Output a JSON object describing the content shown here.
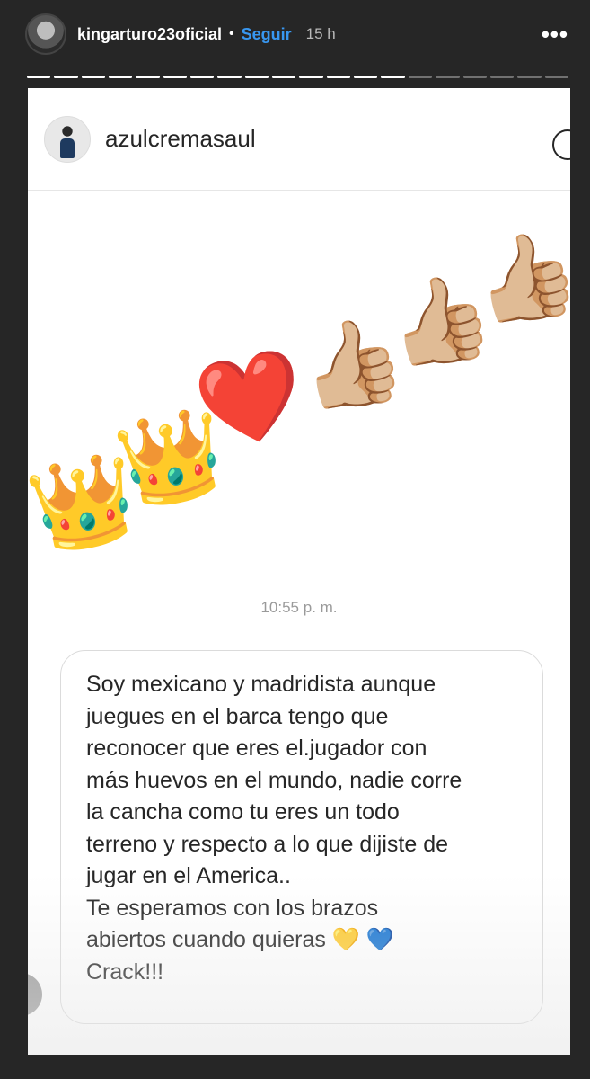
{
  "story": {
    "username": "kingarturo23oficial",
    "separator": "•",
    "follow_label": "Seguir",
    "time_ago": "15 h",
    "more_label": "•••",
    "progress": {
      "segments": 20,
      "completed": 14
    }
  },
  "dm": {
    "username": "azulcremasaul",
    "emojis": [
      "👑",
      "👑",
      "❤️",
      "👍🏼",
      "👍🏼",
      "👍🏼"
    ],
    "timestamp": "10:55 p. m.",
    "message": "Soy mexicano y madridista aunque\njuegues en el barca tengo que\nreconocer que eres el.jugador con\nmás huevos en el mundo, nadie corre\nla cancha como tu eres un todo\nterreno y respecto a lo que dijiste de\njugar en el America..\nTe esperamos con los brazos\nabiertos cuando quieras 💛 💙\nCrack!!!"
  },
  "colors": {
    "follow": "#3897f0",
    "background": "#262626"
  }
}
